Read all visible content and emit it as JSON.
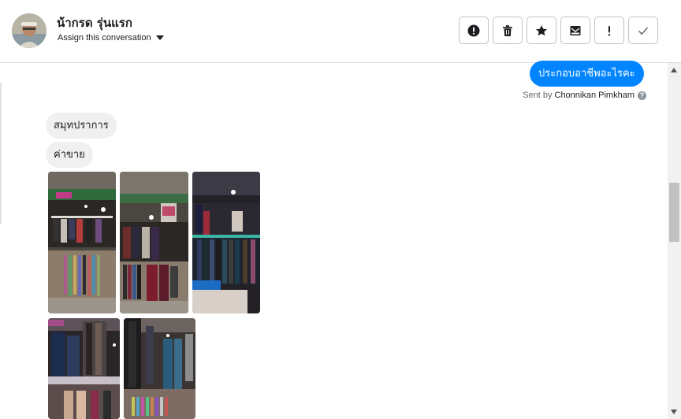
{
  "header": {
    "user_name": "น้ากรด รุ่นแรก",
    "assign_label": "Assign this conversation",
    "actions": [
      {
        "icon": "exclamation-circle-icon",
        "label": ""
      },
      {
        "icon": "trash-icon",
        "label": ""
      },
      {
        "icon": "star-icon",
        "label": ""
      },
      {
        "icon": "mark-unread-icon",
        "label": ""
      },
      {
        "icon": "exclamation-icon",
        "label": ""
      },
      {
        "icon": "checkmark-icon",
        "label": ""
      }
    ]
  },
  "conversation": {
    "sent_message": "ประกอบอาชีพอะไรคะ",
    "sent_by_prefix": "Sent by",
    "sent_by_name": "Chonnikan Pimkham",
    "received_messages": [
      "สมุทปราการ",
      "ค่าขาย"
    ],
    "photos": [
      {
        "subject": "clothing-market-stall-photo"
      },
      {
        "subject": "clothing-market-stall-photo"
      },
      {
        "subject": "clothing-racks-photo"
      },
      {
        "subject": "hanging-clothes-photo"
      },
      {
        "subject": "hanging-pants-photo"
      }
    ]
  },
  "colors": {
    "sent_bubble": "#0084ff",
    "received_bubble": "#f1f0f0",
    "border": "#bec3c9"
  }
}
